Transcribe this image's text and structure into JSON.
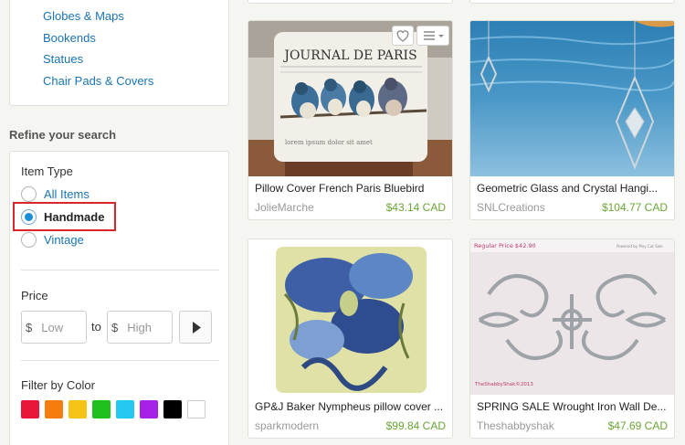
{
  "categories": [
    "Globes & Maps",
    "Bookends",
    "Statues",
    "Chair Pads & Covers"
  ],
  "refine_title": "Refine your search",
  "item_type": {
    "title": "Item Type",
    "options": [
      "All Items",
      "Handmade",
      "Vintage"
    ],
    "selected": "Handmade"
  },
  "price": {
    "title": "Price",
    "currency": "$",
    "low_placeholder": "Low",
    "high_placeholder": "High",
    "to_label": "to",
    "go_icon": "play-triangle-icon"
  },
  "color_filter": {
    "title": "Filter by Color",
    "swatches": [
      "#e8173a",
      "#f57d0f",
      "#f5c316",
      "#1fbf1f",
      "#22c8ef",
      "#a622e8",
      "#000000",
      "#ffffff"
    ]
  },
  "products": [
    {
      "title": "Pillow Cover French Paris Bluebird",
      "shop": "JolieMarche",
      "price": "$43.14 CAD"
    },
    {
      "title": "Geometric Glass and Crystal Hangi...",
      "shop": "SNLCreations",
      "price": "$104.77 CAD"
    },
    {
      "title": "GP&J Baker Nympheus pillow cover ...",
      "shop": "sparkmodern",
      "price": "$99.84 CAD"
    },
    {
      "title": "SPRING SALE Wrought Iron Wall De...",
      "shop": "Theshabbyshak",
      "price": "$47.69 CAD"
    }
  ],
  "image_text": {
    "pillow_print": "JOURNAL DE PARIS",
    "regular_price": "Regular Price $42.90",
    "watermark": "TheShabbyShak©2013",
    "powered_by": "Powered by Pixy Cut Sale"
  },
  "colors": {
    "link": "#1a74b3",
    "price": "#6aa436",
    "highlight": "#d9262c"
  }
}
